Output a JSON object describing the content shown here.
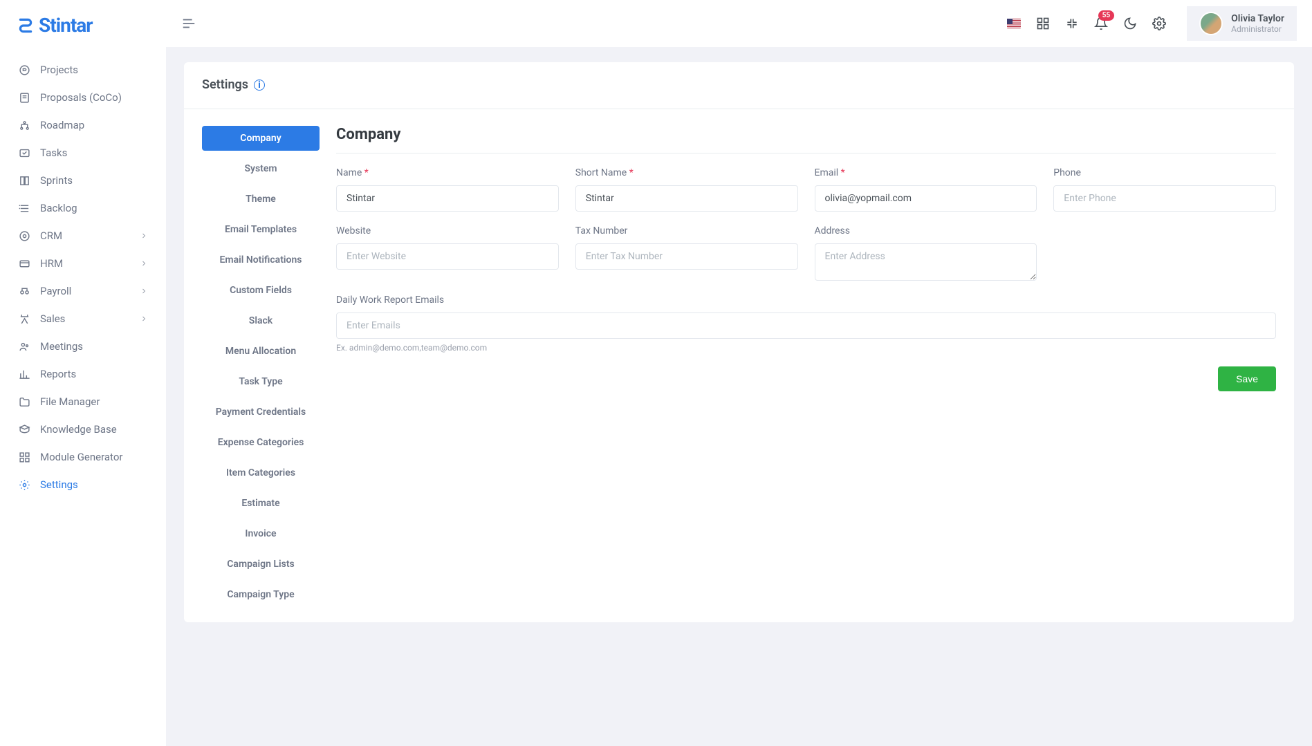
{
  "brand": "Stintar",
  "user": {
    "name": "Olivia Taylor",
    "role": "Administrator"
  },
  "notification_count": "55",
  "sidebar": {
    "items": [
      {
        "label": "Projects",
        "icon": "projects"
      },
      {
        "label": "Proposals (CoCo)",
        "icon": "proposals"
      },
      {
        "label": "Roadmap",
        "icon": "roadmap"
      },
      {
        "label": "Tasks",
        "icon": "tasks"
      },
      {
        "label": "Sprints",
        "icon": "sprints"
      },
      {
        "label": "Backlog",
        "icon": "backlog"
      },
      {
        "label": "CRM",
        "icon": "crm",
        "expandable": true
      },
      {
        "label": "HRM",
        "icon": "hrm",
        "expandable": true
      },
      {
        "label": "Payroll",
        "icon": "payroll",
        "expandable": true
      },
      {
        "label": "Sales",
        "icon": "sales",
        "expandable": true
      },
      {
        "label": "Meetings",
        "icon": "meetings"
      },
      {
        "label": "Reports",
        "icon": "reports"
      },
      {
        "label": "File Manager",
        "icon": "filemanager"
      },
      {
        "label": "Knowledge Base",
        "icon": "knowledge"
      },
      {
        "label": "Module Generator",
        "icon": "module"
      },
      {
        "label": "Settings",
        "icon": "settings",
        "active": true
      }
    ]
  },
  "page": {
    "title": "Settings"
  },
  "tabs": [
    "Company",
    "System",
    "Theme",
    "Email Templates",
    "Email Notifications",
    "Custom Fields",
    "Slack",
    "Menu Allocation",
    "Task Type",
    "Payment Credentials",
    "Expense Categories",
    "Item Categories",
    "Estimate",
    "Invoice",
    "Campaign Lists",
    "Campaign Type"
  ],
  "form": {
    "heading": "Company",
    "fields": {
      "name": {
        "label": "Name",
        "required": true,
        "value": "Stintar"
      },
      "short_name": {
        "label": "Short Name",
        "required": true,
        "value": "Stintar"
      },
      "email": {
        "label": "Email",
        "required": true,
        "value": "olivia@yopmail.com"
      },
      "phone": {
        "label": "Phone",
        "placeholder": "Enter Phone",
        "value": ""
      },
      "website": {
        "label": "Website",
        "placeholder": "Enter Website",
        "value": ""
      },
      "tax_number": {
        "label": "Tax Number",
        "placeholder": "Enter Tax Number",
        "value": ""
      },
      "address": {
        "label": "Address",
        "placeholder": "Enter Address",
        "value": ""
      },
      "report_emails": {
        "label": "Daily Work Report Emails",
        "placeholder": "Enter Emails",
        "hint": "Ex. admin@demo.com,team@demo.com",
        "value": ""
      }
    },
    "save_label": "Save"
  }
}
